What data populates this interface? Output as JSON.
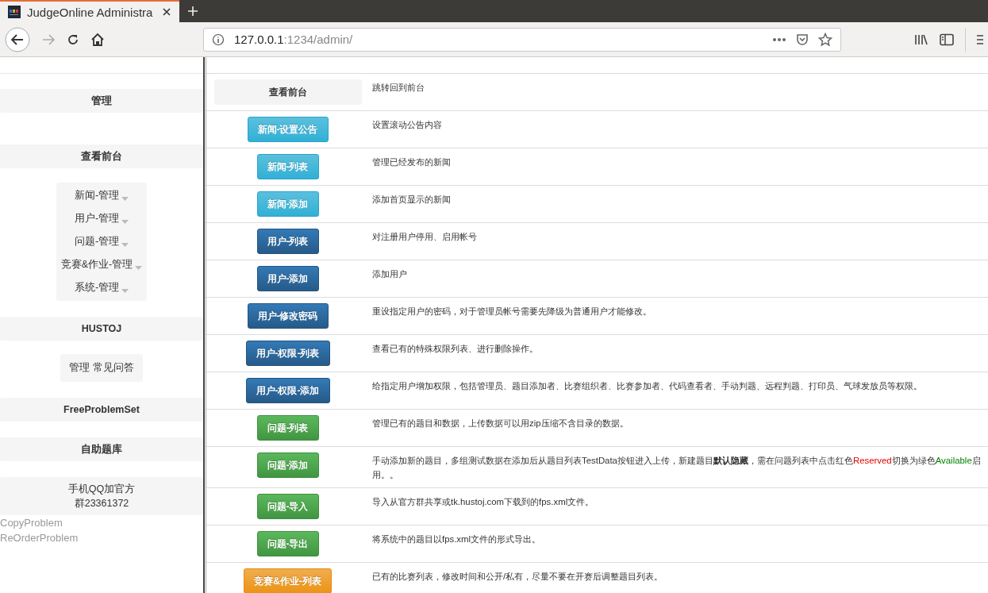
{
  "browser": {
    "tab_title": "JudgeOnline Administra",
    "forward_disabled": true,
    "url": {
      "host": "127.0.0.1",
      "rest": ":1234/admin/"
    }
  },
  "sidebar": [
    {
      "kind": "header",
      "text": "管理"
    },
    {
      "kind": "header",
      "text": "查看前台"
    },
    {
      "kind": "dropdowns",
      "children": [
        {
          "text": "新闻-管理"
        },
        {
          "text": "用户-管理"
        },
        {
          "text": "问题-管理"
        },
        {
          "text": "竞赛&作业-管理"
        },
        {
          "text": "系统-管理"
        }
      ]
    },
    {
      "kind": "header",
      "text": "HUSTOJ"
    },
    {
      "kind": "button",
      "text": "管理 常见问答"
    },
    {
      "kind": "header",
      "text": "FreeProblemSet"
    },
    {
      "kind": "header",
      "text": "自助题库"
    },
    {
      "kind": "note",
      "lines": [
        "手机QQ加官方",
        "群23361372"
      ]
    },
    {
      "kind": "link",
      "text": "CopyProblem"
    },
    {
      "kind": "link",
      "text": "ReOrderProblem"
    }
  ],
  "rows": [
    {
      "button": "查看前台",
      "kind": "default",
      "description": [
        {
          "kind": "plain",
          "text": "跳转回到前台"
        }
      ]
    },
    {
      "button": "新闻-设置公告",
      "kind": "info",
      "description": [
        {
          "kind": "plain",
          "text": "设置滚动公告内容"
        }
      ]
    },
    {
      "button": "新闻-列表",
      "kind": "info",
      "description": [
        {
          "kind": "plain",
          "text": "管理已经发布的新闻"
        }
      ]
    },
    {
      "button": "新闻-添加",
      "kind": "info",
      "description": [
        {
          "kind": "plain",
          "text": "添加首页显示的新闻"
        }
      ]
    },
    {
      "button": "用户-列表",
      "kind": "primary",
      "description": [
        {
          "kind": "plain",
          "text": "对注册用户停用、启用帐号"
        }
      ]
    },
    {
      "button": "用户-添加",
      "kind": "primary",
      "description": [
        {
          "kind": "plain",
          "text": "添加用户"
        }
      ]
    },
    {
      "button": "用户-修改密码",
      "kind": "primary",
      "description": [
        {
          "kind": "plain",
          "text": "重设指定用户的密码，对于管理员帐号需要先降级为普通用户才能修改。"
        }
      ]
    },
    {
      "button": "用户-权限-列表",
      "kind": "primary",
      "description": [
        {
          "kind": "plain",
          "text": "查看已有的特殊权限列表、进行删除操作。"
        }
      ]
    },
    {
      "button": "用户-权限-添加",
      "kind": "primary",
      "description": [
        {
          "kind": "plain",
          "text": "给指定用户增加权限，包括管理员、题目添加者、比赛组织者、比赛参加者、代码查看者、手动判题、远程判题、打印员、气球发放员等权限。"
        }
      ]
    },
    {
      "button": "问题-列表",
      "kind": "success",
      "description": [
        {
          "kind": "plain",
          "text": "管理已有的题目和数据，上传数据可以用zip压缩不含目录的数据。"
        }
      ]
    },
    {
      "button": "问题-添加",
      "kind": "success",
      "description": [
        {
          "kind": "plain",
          "text": "手动添加新的题目，多组测试数据在添加后从题目列表TestData按钮进入上传，新建题目"
        },
        {
          "kind": "bold",
          "text": "默认隐藏"
        },
        {
          "kind": "plain",
          "text": "，需在问题列表中点击红色"
        },
        {
          "kind": "red",
          "text": "Reserved"
        },
        {
          "kind": "plain",
          "text": "切换为绿色"
        },
        {
          "kind": "green",
          "text": "Available"
        },
        {
          "kind": "plain",
          "text": "启用。。"
        }
      ]
    },
    {
      "button": "问题-导入",
      "kind": "success",
      "description": [
        {
          "kind": "plain",
          "text": "导入从官方群共享或tk.hustoj.com下载到的fps.xml文件。"
        }
      ]
    },
    {
      "button": "问题-导出",
      "kind": "success",
      "description": [
        {
          "kind": "plain",
          "text": "将系统中的题目以fps.xml文件的形式导出。"
        }
      ]
    },
    {
      "button": "竞赛&作业-列表",
      "kind": "warning",
      "description": [
        {
          "kind": "plain",
          "text": "已有的比赛列表，修改时间和公开/私有，尽量不要在开赛后调整题目列表。"
        }
      ]
    }
  ]
}
